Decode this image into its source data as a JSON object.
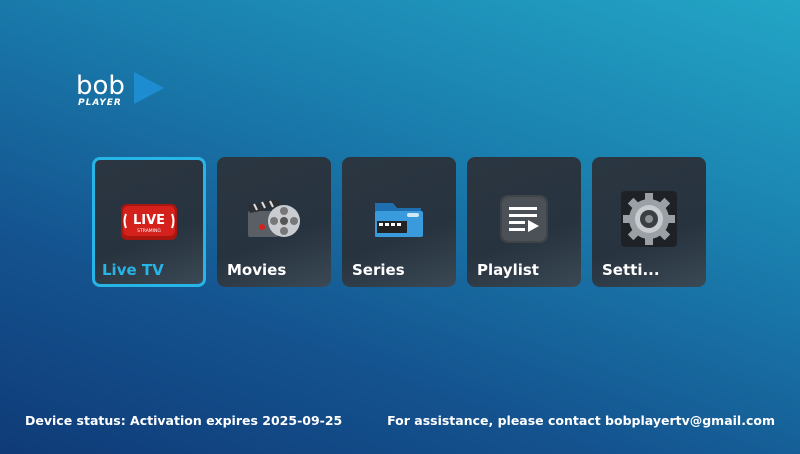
{
  "brand": {
    "logo_text": "bob",
    "logo_subtext": "PLAYER"
  },
  "menu": [
    {
      "label": "Live TV",
      "icon": "live-streaming-icon",
      "active": true
    },
    {
      "label": "Movies",
      "icon": "film-reel-icon",
      "active": false
    },
    {
      "label": "Series",
      "icon": "folder-film-icon",
      "active": false
    },
    {
      "label": "Playlist",
      "icon": "playlist-icon",
      "active": false
    },
    {
      "label": "Setti...",
      "icon": "gear-icon",
      "active": false
    }
  ],
  "live_badge": {
    "text": "LIVE",
    "subtext": "STRAMING"
  },
  "footer": {
    "device_status": "Device status: Activation expires 2025-09-25",
    "assistance": "For assistance, please contact  bobplayertv@gmail.com"
  },
  "colors": {
    "accent": "#27b4e6",
    "tile_bg": "#2b3641",
    "live_red": "#d4211c"
  }
}
